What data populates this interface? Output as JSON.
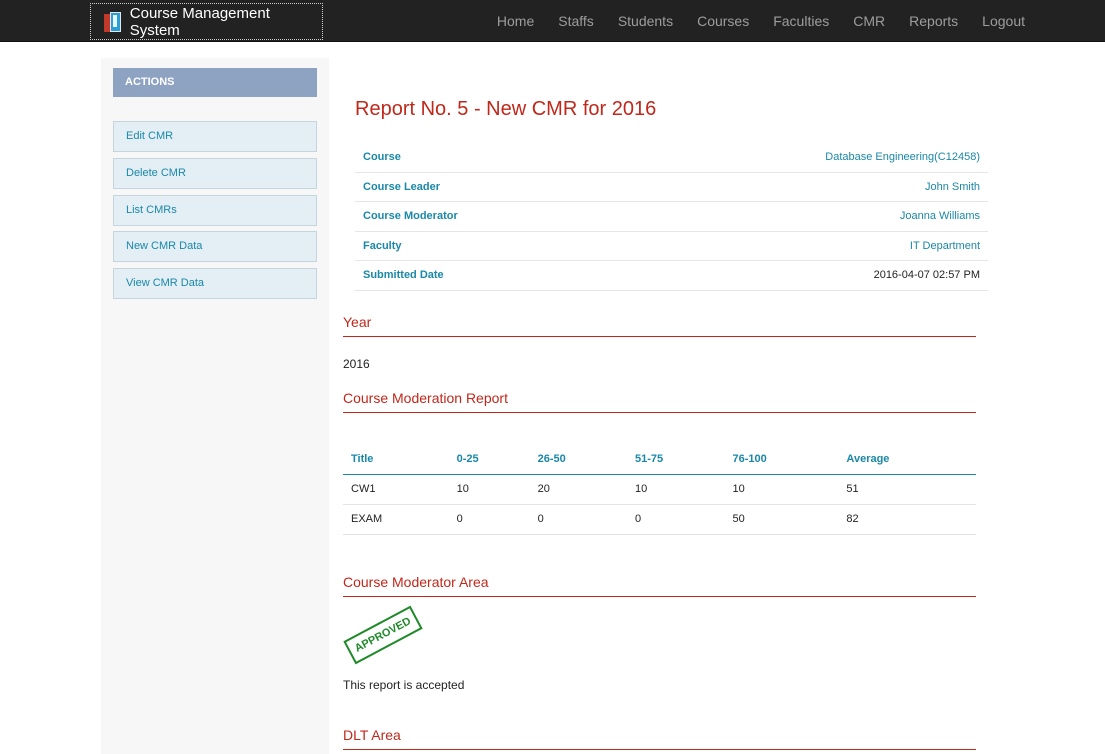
{
  "navbar": {
    "brand": "Course Management System",
    "links": [
      "Home",
      "Staffs",
      "Students",
      "Courses",
      "Faculties",
      "CMR",
      "Reports",
      "Logout"
    ]
  },
  "sidebar": {
    "header": "ACTIONS",
    "items": [
      "Edit CMR",
      "Delete CMR",
      "List CMRs",
      "New CMR Data",
      "View CMR Data"
    ]
  },
  "report": {
    "title": "Report No. 5 - New CMR for 2016",
    "details": [
      {
        "label": "Course",
        "value": "Database Engineering(C12458)"
      },
      {
        "label": "Course Leader",
        "value": "John Smith"
      },
      {
        "label": "Course Moderator",
        "value": "Joanna Williams"
      },
      {
        "label": "Faculty",
        "value": "IT Department"
      },
      {
        "label": "Submitted Date",
        "value": "2016-04-07 02:57 PM"
      }
    ]
  },
  "year_section": {
    "title": "Year",
    "value": "2016"
  },
  "moderation_section": {
    "title": "Course Moderation Report",
    "columns": [
      "Title",
      "0-25",
      "26-50",
      "51-75",
      "76-100",
      "Average"
    ],
    "rows": [
      [
        "CW1",
        "10",
        "20",
        "10",
        "10",
        "51"
      ],
      [
        "EXAM",
        "0",
        "0",
        "0",
        "50",
        "82"
      ]
    ]
  },
  "moderator_section": {
    "title": "Course Moderator Area",
    "stamp": "APPROVED",
    "note": "This report is accepted"
  },
  "dlt_section": {
    "title": "DLT Area"
  },
  "colors": {
    "navbar": "#222222",
    "accent": "#c0281b",
    "link": "#1a88a8",
    "stamp": "#1f8a2a",
    "sidebar_header": "#8ea2c2"
  }
}
